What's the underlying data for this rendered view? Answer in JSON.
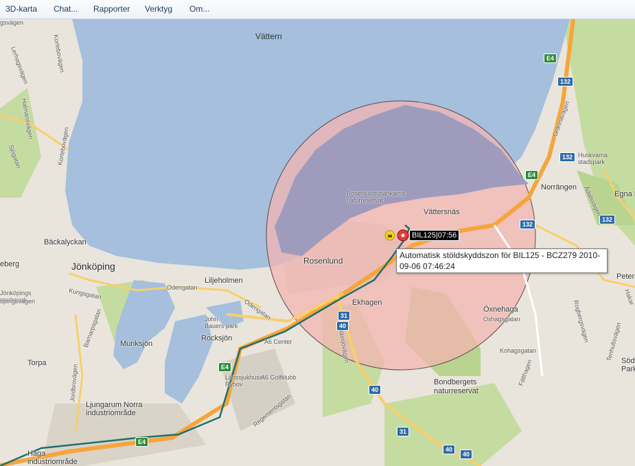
{
  "menu": {
    "items": [
      "3D-karta",
      "Chat...",
      "Rapporter",
      "Verktyg",
      "Om..."
    ]
  },
  "map": {
    "labels": {
      "vattern": "Vättern",
      "jonkoping": "Jönköping",
      "backalyckan": "Bäckalyckan",
      "liljeholmen": "Liljeholmen",
      "rosenlund": "Rosenlund",
      "vattersnas": "Vättersnäs",
      "ekhagen": "Ekhagen",
      "oxnehaga": "Öxnehaga",
      "norrangen": "Norrängen",
      "egna_hem": "Egna H",
      "munksjon": "Munksjön",
      "rocksjon": "Rocksjön",
      "torpa": "Torpa",
      "ljungarum": "Ljungarum Norra industriområde",
      "haga": "Haga industriområde",
      "lansjukhuset": "Länssjukhuset Ryhov",
      "a6_center": "A6 Center",
      "a6_golf": "A6 Golfklubb",
      "john_bauer": "John Bauers park",
      "rosenlundsbankarna": "Rosenlundsbankarna naturreservat",
      "bondbergets": "Bondbergets naturreservat",
      "huskvarna": "Huskvarna stadspark",
      "jonkopings_stadspark": "Jönköpings stadspark",
      "eberg": "eberg",
      "peter": "Peter",
      "sod": "Söd Park",
      "odengatan1": "Odengatan",
      "odengatan2": "Odengatan",
      "kungsgatan": "Kungsgatan",
      "barnarpsgatan": "Barnarpsgatan",
      "jordbrovagen": "Jordbrovägen",
      "regementsgatan": "Regementsgatan",
      "nassjovagen": "Nässjövägen",
      "grannavagen": "Grännavägen",
      "atalsvagen": "Ådalsvägen",
      "oxhagsgatan": "Oxhagsgatan",
      "kohagsgatan": "Kohagsgatan",
      "falthagen": "Fälthagen",
      "rogbergsvagen": "Rogbergsvägen",
      "tenhultsvagen": "Tenhultsvägen",
      "halmansvagen": "Halmansvägen",
      "kortebovagen": "Kortebovägen",
      "kortebovagen2": "Kortebovägen",
      "lerhagsvagen": "Lerhagsvägen",
      "sjogatan": "Sjögatan",
      "gsvagen": "gsvägen",
      "kopingsvagen": "öpingsvägen",
      "hakar": "Hakar"
    },
    "shields": {
      "e4_top": "E4",
      "s132_a": "132",
      "s132_b": "132",
      "e4_mid": "E4",
      "s132_c": "132",
      "s132_d": "132",
      "s31_a": "31",
      "s40_a": "40",
      "s40_b": "40",
      "s31_b": "31",
      "s40_c": "40",
      "s40_d": "40",
      "e4_low": "E4",
      "e4_bottom": "E4"
    },
    "vehicle": {
      "label": "BIL125|07:56"
    },
    "tooltip": {
      "text": "Automatisk stöldskyddszon för BIL125 - BCZ279 2010-09-06 07:46:24"
    },
    "colors": {
      "water": "#a5bfdd",
      "land": "#e9e5dc",
      "park": "#c5dca0",
      "highway": "#f6a53a",
      "route": "#1f6f6f",
      "zone_fill": "#f3b4b0",
      "zone_water": "#9f9bbd",
      "zone_border": "#5a4a4a"
    }
  }
}
